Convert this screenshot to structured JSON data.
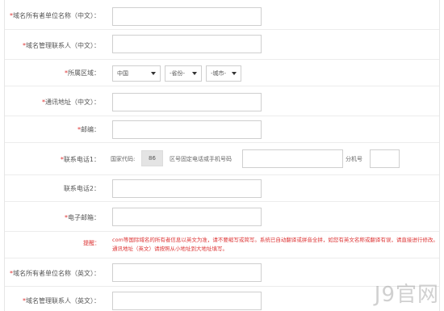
{
  "form": {
    "org_cn_label": "域名所有者单位名称（中文）：",
    "contact_cn_label": "域名管理联系人（中文）：",
    "region_label": "所属区域：",
    "country_value": "中国",
    "province_value": "-省份-",
    "city_value": "-城市-",
    "address_cn_label": "通讯地址（中文）：",
    "zip_label": "邮编：",
    "phone1_label": "联系电话1：",
    "country_code_label": "国家代码:",
    "country_code_value": "86",
    "area_code_label": "区号固定电话或手机号码",
    "ext_label": "分机号",
    "phone2_label": "联系电话2：",
    "email_label": "电子邮箱：",
    "notice_label": "提醒：",
    "notice_text": "com等国际域名的所有者信息以英文为准，请不要缩写或简写。系统已自动翻译或拼音全拼，如您有英文名称或翻译有误，请直接进行修改。通讯地址（英文）请按照从小地址到大地址填写。",
    "org_en_label": "域名所有者单位名称（英文）：",
    "contact_en_label": "域名管理联系人（英文）："
  },
  "watermark": "J9官网",
  "colors": {
    "required": "#dd3333",
    "notice": "#dd3333",
    "border": "#cfcfcf"
  }
}
